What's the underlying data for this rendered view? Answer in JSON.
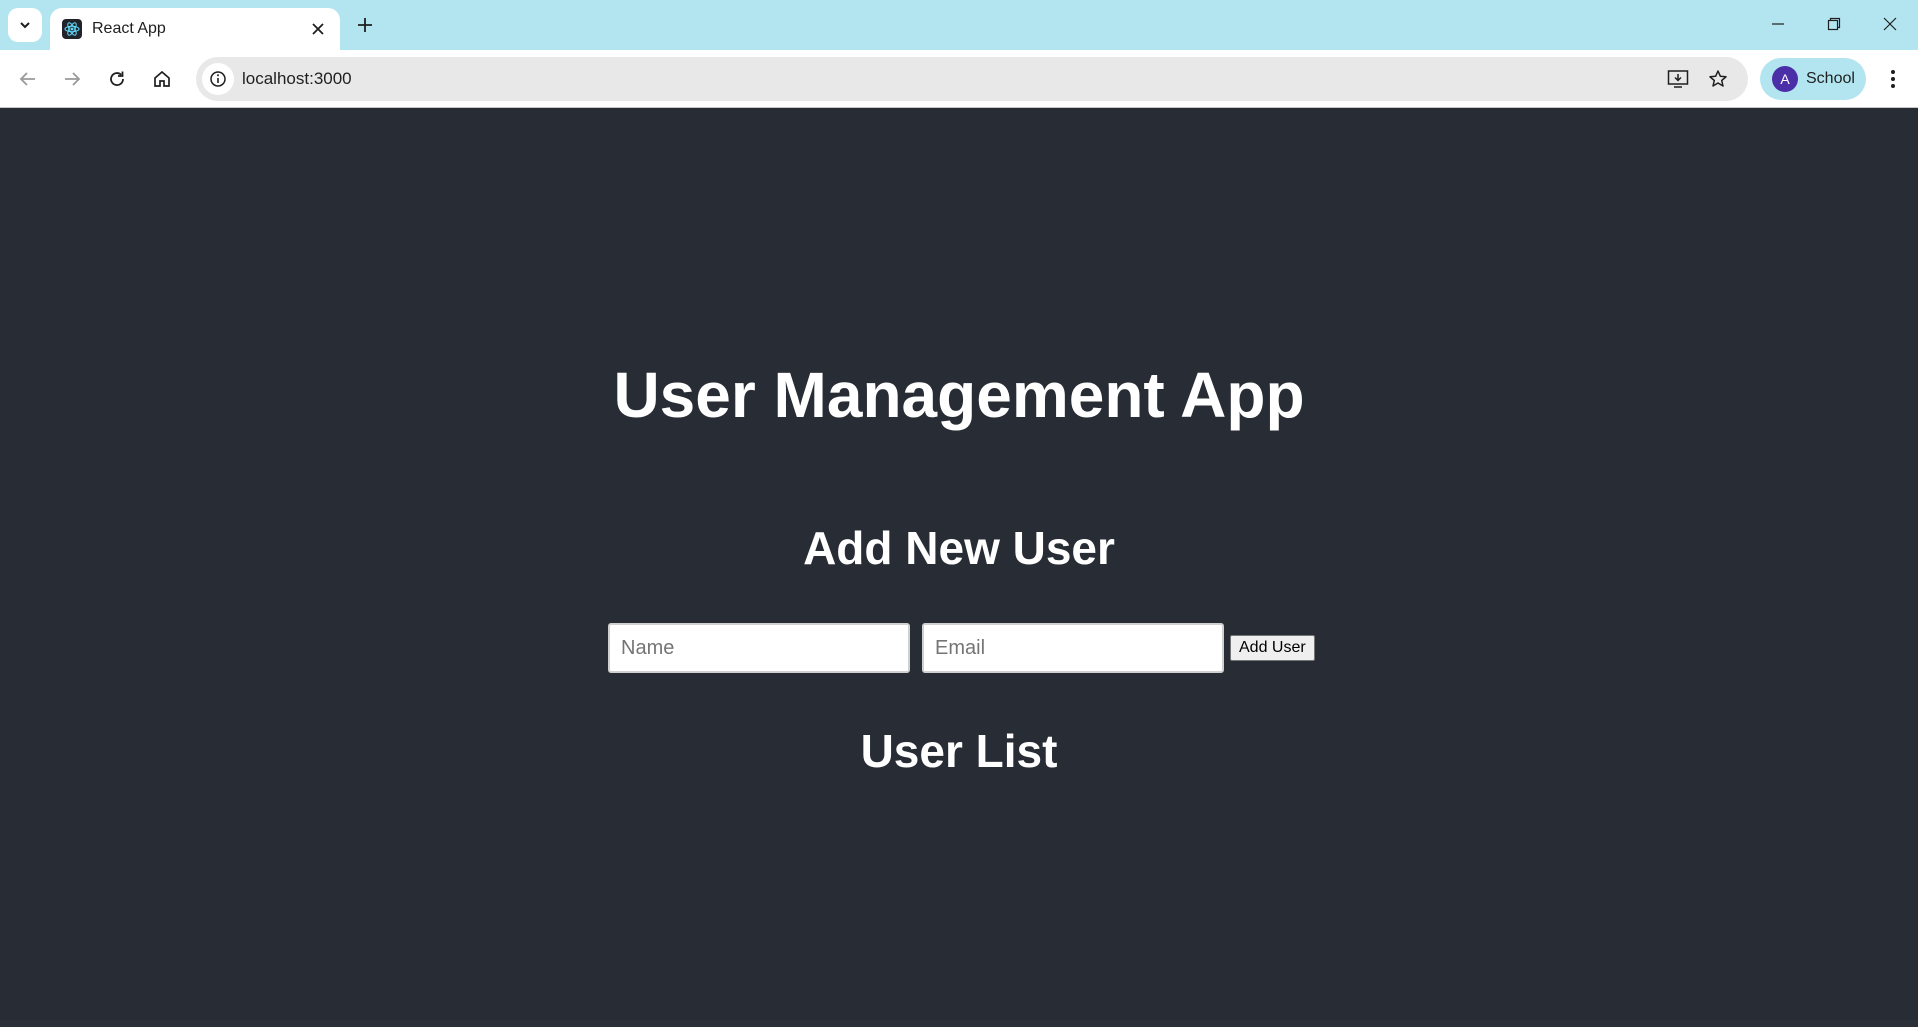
{
  "browser": {
    "tab_title": "React App",
    "url": "localhost:3000",
    "profile_initial": "A",
    "profile_label": "School"
  },
  "app": {
    "title": "User Management App",
    "form": {
      "heading": "Add New User",
      "name_placeholder": "Name",
      "email_placeholder": "Email",
      "submit_label": "Add User"
    },
    "list": {
      "heading": "User List",
      "users": []
    }
  },
  "colors": {
    "page_background": "#282c34",
    "tabstrip": "#b3e5f0",
    "avatar": "#4b2fa8"
  }
}
